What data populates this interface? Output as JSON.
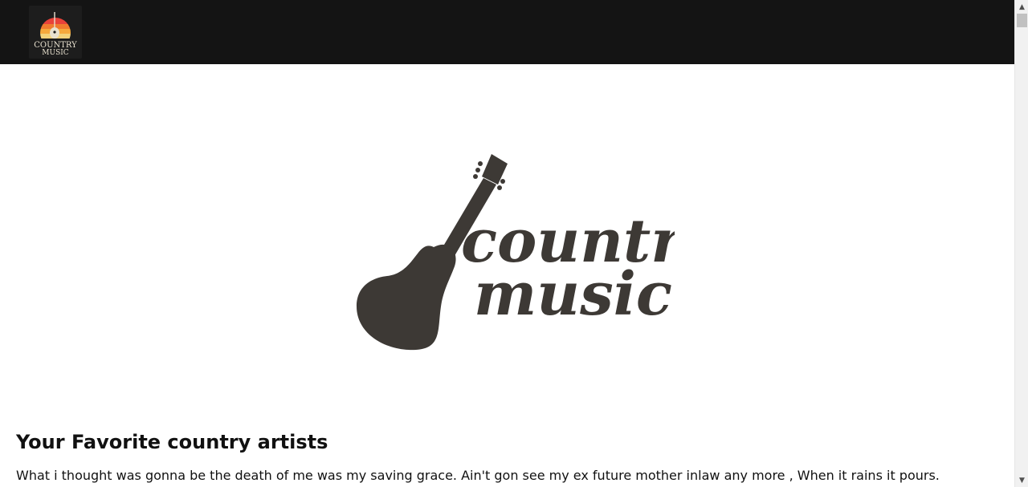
{
  "header": {
    "logo": {
      "line1": "COUNTRY",
      "line2": "MUSIC",
      "colors": [
        "#e8423a",
        "#f07b2f",
        "#f6a93c",
        "#f3d27a"
      ]
    }
  },
  "hero": {
    "logo": {
      "line1": "country",
      "line2": "music",
      "color": "#3d3935"
    }
  },
  "content": {
    "heading": "Your Favorite country artists",
    "paragraph": "What i thought was gonna be the death of me was my saving grace. Ain't gon see my ex future mother inlaw any more , When it rains it pours."
  },
  "scrollbar": {
    "up_icon": "chevron-up-icon",
    "down_icon": "chevron-down-icon"
  }
}
